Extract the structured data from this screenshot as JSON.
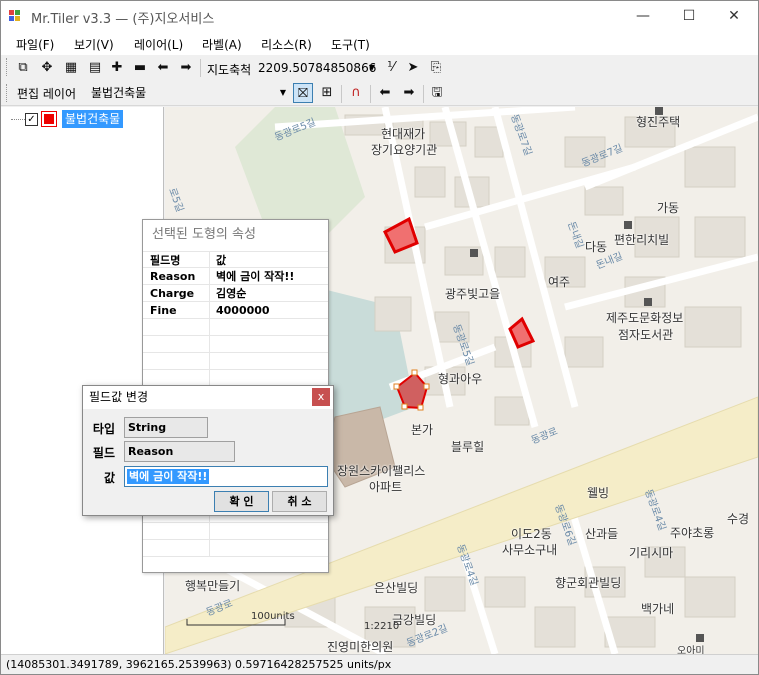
{
  "window": {
    "title": "Mr.Tiler v3.3 — (주)지오서비스"
  },
  "menu": [
    "파일(F)",
    "보기(V)",
    "레이어(L)",
    "라벨(A)",
    "리소스(R)",
    "도구(T)"
  ],
  "toolbar1": {
    "scale_label": "지도축척",
    "scale_value": "2209.50784850866"
  },
  "toolbar2": {
    "edit_layer_label": "편집 레이어",
    "edit_layer_value": "불법건축물"
  },
  "tree": {
    "layer_name": "불법건축물",
    "checked": "✓"
  },
  "map": {
    "labels": [
      "현대재가",
      "장기요양기관",
      "형진주택",
      "가동",
      "편한리치빌",
      "다동",
      "광주빛고을",
      "여주",
      "제주도문화정보",
      "점자도서관",
      "형과아우",
      "본가",
      "블루힐",
      "장원스카이팰리스",
      "아파트",
      "웰빙",
      "이도2동",
      "사무소구내",
      "산과들",
      "주야초롱",
      "수경",
      "기리시마",
      "향군회관빌딩",
      "행복만들기",
      "은산빌딩",
      "백가네",
      "금강빌딩",
      "진영미한의원",
      "오아미"
    ],
    "road_labels": [
      "동광로5길",
      "동광로7길",
      "동광로7길",
      "로5길",
      "동광로5길",
      "돈내길",
      "돈내길",
      "동광로",
      "동광로6길",
      "동광로4길",
      "동광로",
      "동광로2길",
      "동광로4길"
    ],
    "scale_bar": "100units",
    "scale_ratio": "1:2210"
  },
  "status": {
    "text": "(14085301.3491789, 3962165.2539963)  0.59716428257525 units/px"
  },
  "properties_panel": {
    "title": "선택된 도형의 속성",
    "header": {
      "field": "필드명",
      "value": "값"
    },
    "rows": [
      {
        "field": "Reason",
        "value": "벽에 금이 작작!!"
      },
      {
        "field": "Charge",
        "value": "김영순"
      },
      {
        "field": "Fine",
        "value": "4000000"
      }
    ]
  },
  "dialog": {
    "title": "필드값 변경",
    "type_label": "타입",
    "type_value": "String",
    "field_label": "필드",
    "field_value": "Reason",
    "value_label": "값",
    "value_value": "벽에 금이 작작!!",
    "ok_label": "확 인",
    "cancel_label": "취 소"
  }
}
